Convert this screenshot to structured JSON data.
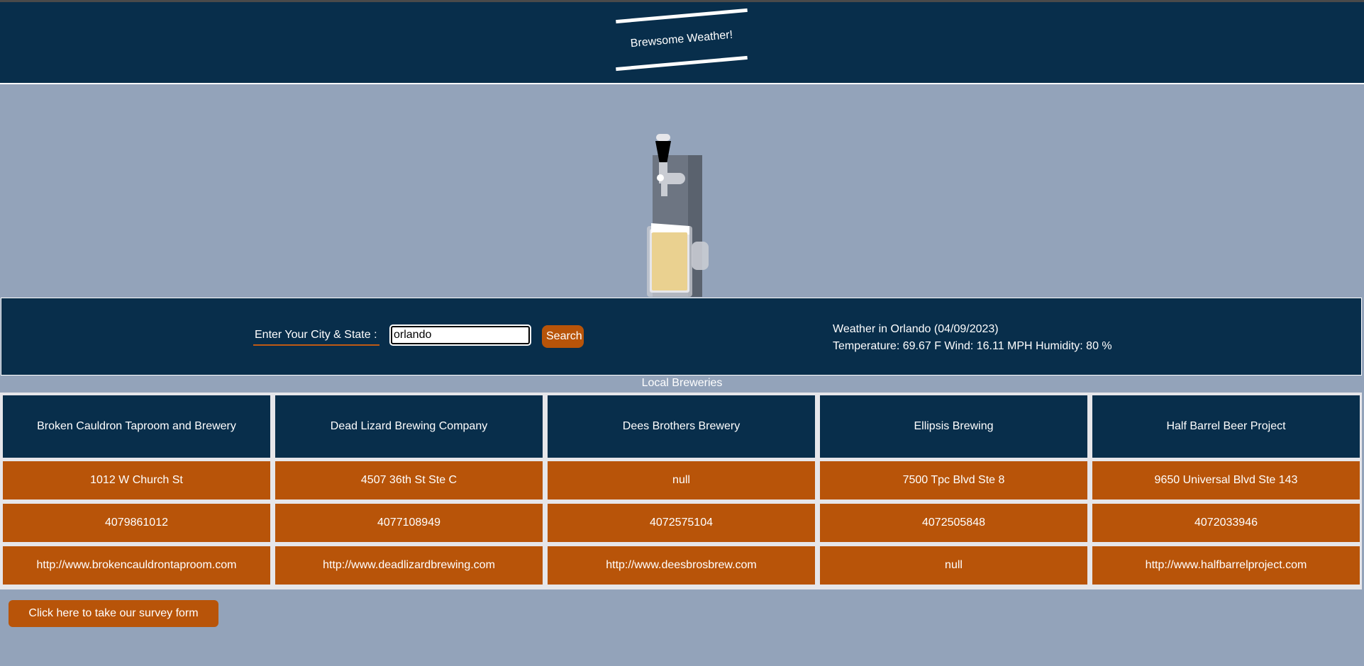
{
  "header": {
    "title": "Brewsome Weather!"
  },
  "search": {
    "label": "Enter Your City & State :",
    "value": "orlando",
    "button_label": "Search"
  },
  "weather": {
    "heading": "Weather in Orlando (04/09/2023)",
    "details": "Temperature: 69.67 F Wind: 16.11 MPH Humidity: 80 %"
  },
  "breweries": {
    "title": "Local Breweries",
    "items": [
      {
        "name": "Broken Cauldron Taproom and Brewery",
        "address": "1012 W Church St",
        "phone": "4079861012",
        "url": "http://www.brokencauldrontaproom.com"
      },
      {
        "name": "Dead Lizard Brewing Company",
        "address": "4507 36th St Ste C",
        "phone": "4077108949",
        "url": "http://www.deadlizardbrewing.com"
      },
      {
        "name": "Dees Brothers Brewery",
        "address": "null",
        "phone": "4072575104",
        "url": "http://www.deesbrosbrew.com"
      },
      {
        "name": "Ellipsis Brewing",
        "address": "7500 Tpc Blvd Ste 8",
        "phone": "4072505848",
        "url": "null"
      },
      {
        "name": "Half Barrel Beer Project",
        "address": "9650 Universal Blvd Ste 143",
        "phone": "4072033946",
        "url": "http://www.halfbarrelproject.com"
      }
    ]
  },
  "survey": {
    "button_label": "Click here to take our survey form"
  },
  "colors": {
    "navy": "#082e4b",
    "orange": "#b85409",
    "background": "#93a3ba"
  },
  "icons": {
    "hero": "beer-tap-icon"
  }
}
